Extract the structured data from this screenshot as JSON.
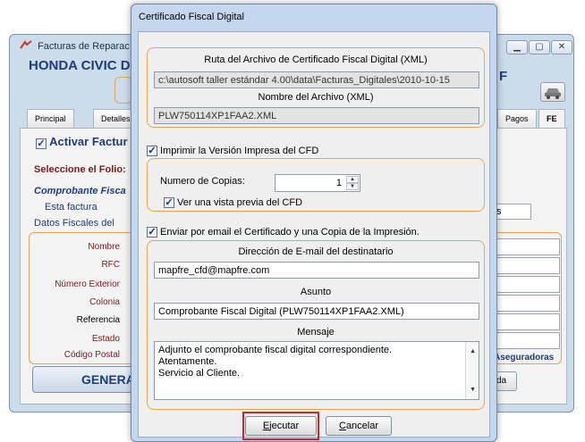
{
  "background": {
    "window_title": "Facturas de Reparac",
    "heading": "HONDA CIVIC D",
    "heading_right": "F",
    "tabs": [
      "Principal",
      "Detalles",
      "Pagos",
      "FE"
    ],
    "activar_label": "Activar Factur",
    "folio_label": "Seleccione el Folio:",
    "comprobante_label": "Comprobante Fisca",
    "esta_factura": "Esta factura",
    "datos_fiscales": "Datos Fiscales del",
    "s_label": "s",
    "field_labels": [
      "Nombre",
      "RFC",
      "Número Exterior",
      "Colonia",
      "Referencia",
      "Estado",
      "Código Postal"
    ],
    "aseguradoras_label": "Aseguradoras",
    "generar_label": "GENERAR",
    "da_label": "da"
  },
  "dialog": {
    "title": "Certificado Fiscal Digital",
    "path_group": {
      "ruta_label": "Ruta del Archivo de Certificado Fiscal Digital (XML)",
      "ruta_value": "c:\\autosoft taller estándar 4.00\\data\\Facturas_Digitales\\2010-10-15",
      "nombre_label": "Nombre del Archivo (XML)",
      "nombre_value": "PLW750114XP1FAA2.XML"
    },
    "imprimir": {
      "label": "Imprimir la Versión Impresa del CFD",
      "checked": true,
      "copias_label": "Numero de Copias:",
      "copias_value": "1",
      "preview_label": "Ver una vista previa del CFD",
      "preview_checked": true
    },
    "email": {
      "label": "Enviar por email el Certificado y una Copia de la Impresión.",
      "checked": true,
      "direccion_label": "Dirección de E-mail del destinatario",
      "direccion_value": "mapfre_cfd@mapfre.com",
      "asunto_label": "Asunto",
      "asunto_value": "Comprobante Fiscal Digital (PLW750114XP1FAA2.XML)",
      "mensaje_label": "Mensaje",
      "mensaje_lines": [
        "Adjunto el comprobante fiscal digital correspondiente.",
        "Atentamente.",
        "Servicio al Cliente."
      ]
    },
    "buttons": {
      "ejecutar_key": "E",
      "ejecutar_rest": "jecutar",
      "cancelar_key": "C",
      "cancelar_rest": "ancelar"
    }
  },
  "colors": {
    "group_border": "#e8a25a",
    "highlight": "#d2232a",
    "heading": "#1e3c78"
  }
}
